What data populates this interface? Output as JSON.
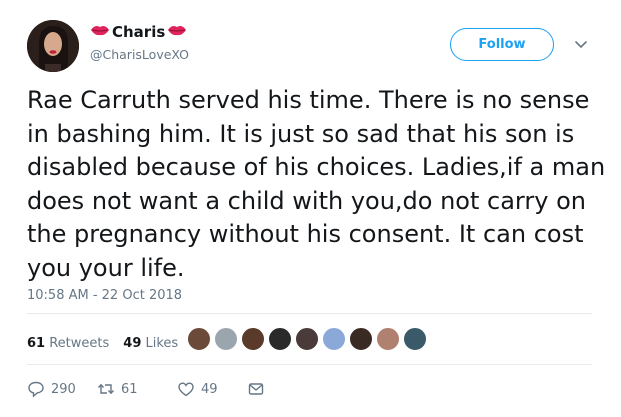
{
  "user": {
    "display_name": "Charis",
    "handle": "@CharisLoveXO",
    "avatar_icon": "profile-avatar",
    "emoji_icon": "kiss-lips-icon"
  },
  "header": {
    "follow_label": "Follow",
    "caret_icon": "chevron-down-icon"
  },
  "tweet": {
    "text": "Rae Carruth served his time. There is no sense in bashing him. It is just so sad that his son is disabled because of his choices. Ladies,if a man does not want a child with you,do not carry on the pregnancy without his consent. It can cost you your life.",
    "timestamp": "10:58 AM - 22 Oct 2018"
  },
  "stats": {
    "retweets_count": "61",
    "retweets_label": "Retweets",
    "likes_count": "49",
    "likes_label": "Likes"
  },
  "likers": [
    {
      "color": "#6b4a3a"
    },
    {
      "color": "#9aa5ad"
    },
    {
      "color": "#5a3a2a"
    },
    {
      "color": "#2a2a2a"
    },
    {
      "color": "#4a3a3a"
    },
    {
      "color": "#8aa8d8"
    },
    {
      "color": "#3a2a24"
    },
    {
      "color": "#b08070"
    },
    {
      "color": "#3a5a6a"
    }
  ],
  "actions": {
    "reply_count": "290",
    "retweet_count": "61",
    "like_count": "49"
  },
  "colors": {
    "accent": "#1da1f2",
    "muted": "#657786",
    "brand_red": "#e0245e"
  }
}
